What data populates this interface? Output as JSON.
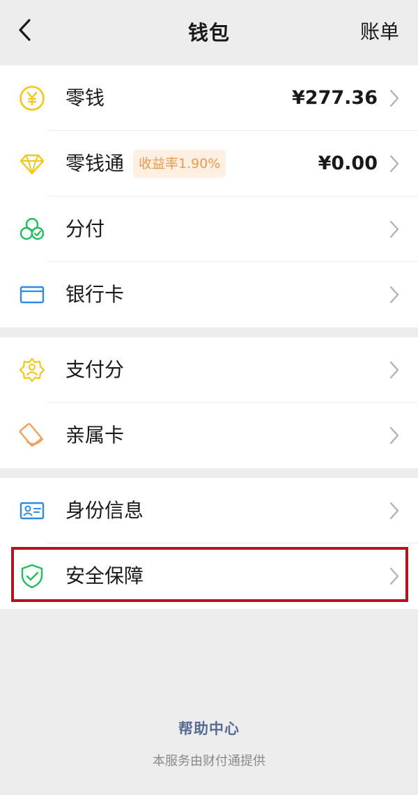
{
  "nav": {
    "title": "钱包",
    "right_label": "账单"
  },
  "groups": [
    {
      "items": [
        {
          "id": "lingqian",
          "label": "零钱",
          "value": "¥277.36",
          "icon": "yuan-coin-icon"
        },
        {
          "id": "lingqiantong",
          "label": "零钱通",
          "badge": "收益率1.90%",
          "value": "¥0.00",
          "icon": "diamond-icon"
        },
        {
          "id": "fenfu",
          "label": "分付",
          "icon": "fenfu-clover-icon"
        },
        {
          "id": "yinhangka",
          "label": "银行卡",
          "icon": "bank-card-icon"
        }
      ]
    },
    {
      "items": [
        {
          "id": "zhifufen",
          "label": "支付分",
          "icon": "score-badge-icon"
        },
        {
          "id": "qinshuka",
          "label": "亲属卡",
          "icon": "family-card-icon"
        }
      ]
    },
    {
      "items": [
        {
          "id": "shenfen",
          "label": "身份信息",
          "icon": "id-card-icon"
        },
        {
          "id": "anquan",
          "label": "安全保障",
          "icon": "shield-check-icon"
        }
      ]
    }
  ],
  "footer": {
    "help": "帮助中心",
    "note": "本服务由财付通提供"
  },
  "colors": {
    "background": "#ededed",
    "accent_link": "#576b95",
    "highlight_border": "#b5121b",
    "badge_text": "#eb9a4a"
  }
}
